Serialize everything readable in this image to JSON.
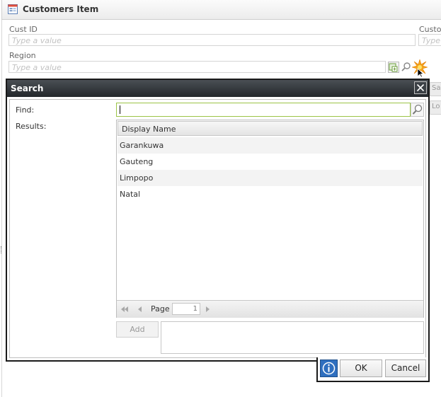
{
  "form": {
    "title": "Customers Item",
    "cust_id_label": "Cust ID",
    "cust_id_placeholder": "Type a value",
    "custom_label_partial": "Custo",
    "custom_placeholder_partial": "Type",
    "region_label": "Region",
    "region_placeholder": "Type a value",
    "edge_text_1": "Sa",
    "edge_text_2": "Lo"
  },
  "dialog": {
    "title": "Search",
    "find_label": "Find:",
    "find_value": "",
    "results_label": "Results:",
    "column_header": "Display Name",
    "results": [
      "Garankuwa",
      "Gauteng",
      "Limpopo",
      "Natal"
    ],
    "pager": {
      "page_label": "Page",
      "page_value": "1"
    },
    "add_label": "Add",
    "ok_label": "OK",
    "cancel_label": "Cancel"
  },
  "colors": {
    "header_dark": "#23272b",
    "find_border": "#9bc447",
    "info_blue": "#2f6fbf"
  },
  "icons": [
    "form-icon",
    "lookup-icon",
    "search-icon",
    "sparkle-icon",
    "cursor-icon",
    "close-icon",
    "first-page-icon",
    "prev-page-icon",
    "next-page-icon",
    "info-icon"
  ]
}
